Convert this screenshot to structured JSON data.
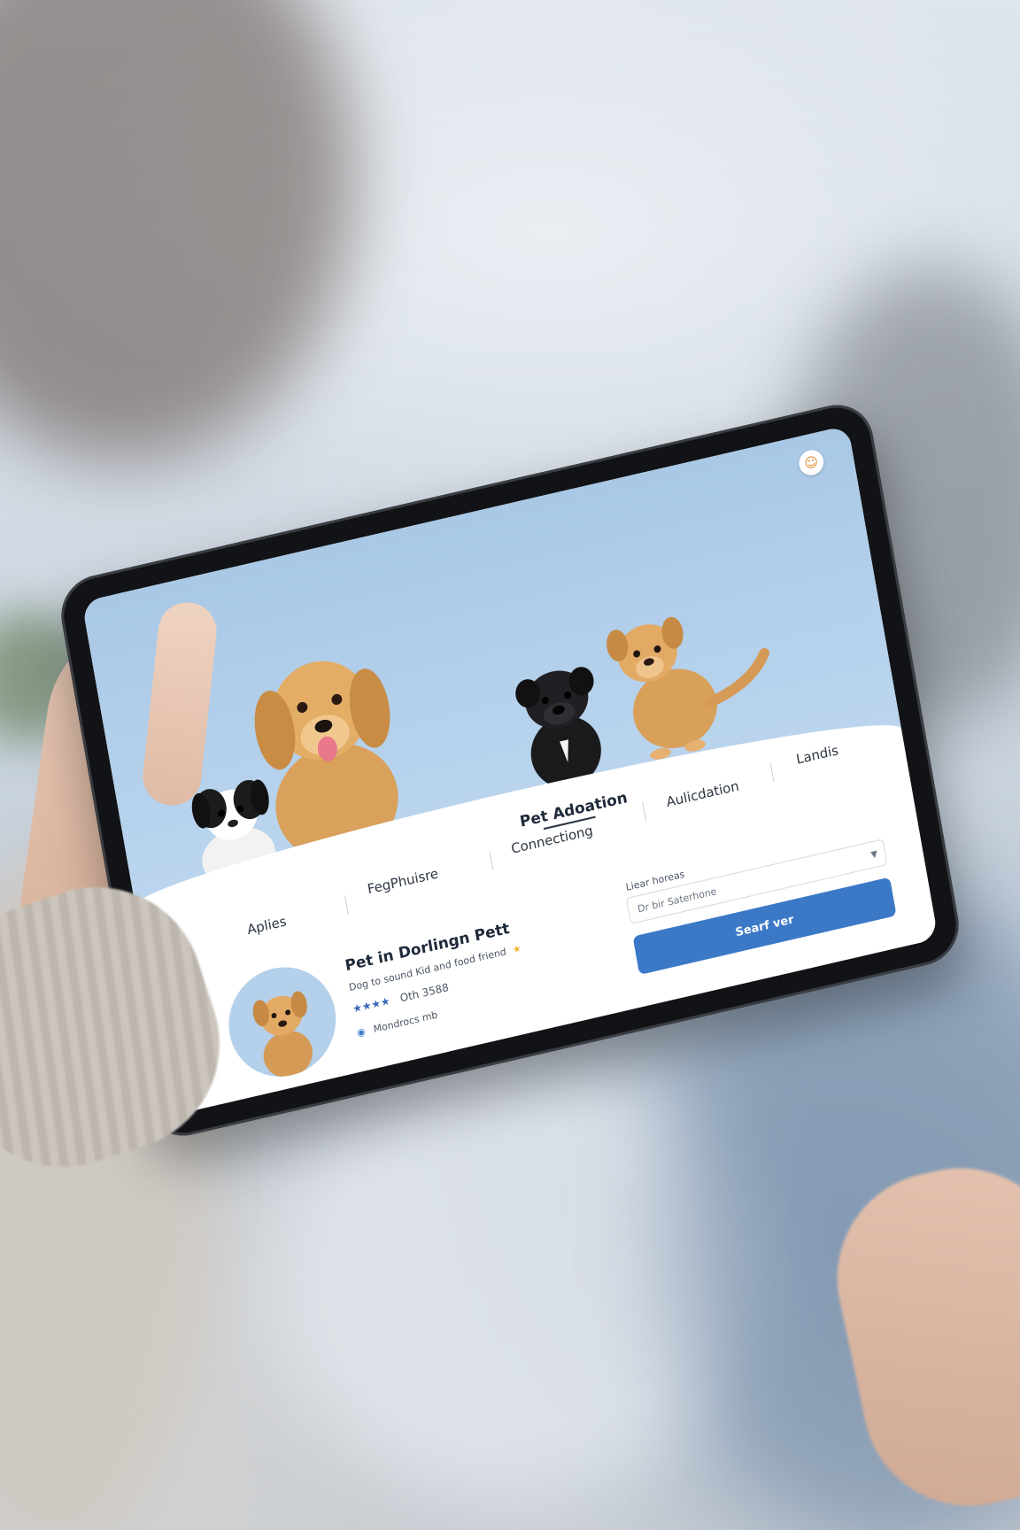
{
  "app": {
    "title": "Pet Adoation",
    "profile_icon": "user-icon"
  },
  "nav": {
    "items": [
      {
        "label": "Aplies"
      },
      {
        "label": "FegPhuisre"
      },
      {
        "label": "Connectiong"
      },
      {
        "label": "Pet Adoation",
        "active": true
      },
      {
        "label": "Aulicdation"
      },
      {
        "label": "Landis"
      }
    ]
  },
  "pet_card": {
    "name": "Pet in Dorlingn Pett",
    "description": "Dog to sound Kid and food friend",
    "stars": "★★★★",
    "rating": "Oth 3588",
    "rating_icon": "star-icon",
    "location_icon": "pin-icon",
    "location": "Mondrocs mb"
  },
  "form": {
    "label": "Liear horeas",
    "select_value": "Dr bir Saterhone",
    "button_label": "Searf ver"
  },
  "colors": {
    "accent": "#3b79c7",
    "hero_sky": "#a9c8e6",
    "tablet_bezel": "#111316"
  }
}
